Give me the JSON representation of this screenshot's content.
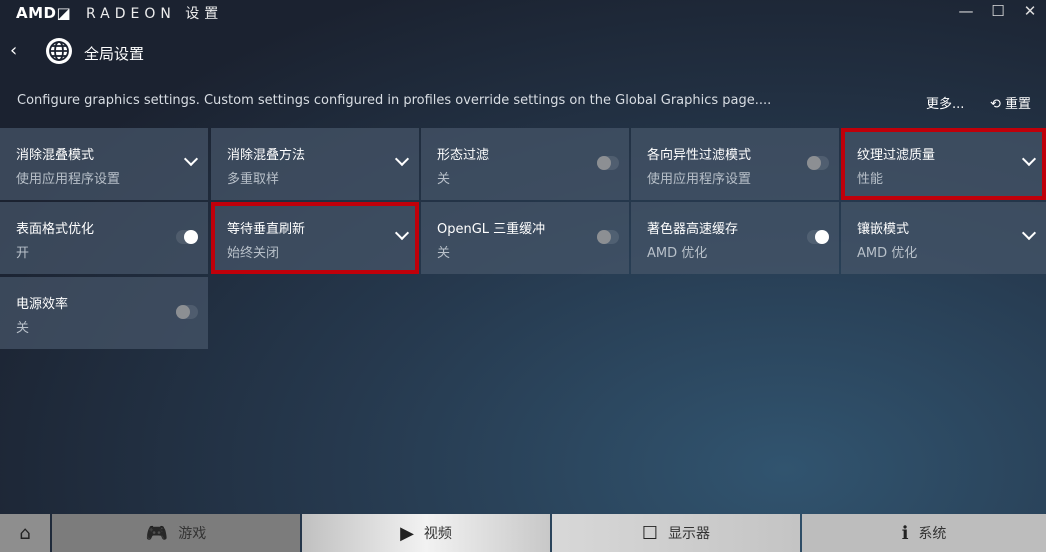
{
  "titlebar": {
    "logo": "AMD◪",
    "title": "RADEON 设置",
    "minimize": "—",
    "maximize": "☐",
    "close": "✕"
  },
  "nav": {
    "back": "‹",
    "title": "全局设置"
  },
  "description": "Configure graphics settings. Custom settings configured in profiles override settings on the Global Graphics page....",
  "actions": {
    "more": "更多...",
    "reset": "重置",
    "reset_icon": "⟲"
  },
  "tiles": [
    {
      "name": "消除混叠模式",
      "value": "使用应用程序设置",
      "control": "dropdown"
    },
    {
      "name": "消除混叠方法",
      "value": "多重取样",
      "control": "dropdown"
    },
    {
      "name": "形态过滤",
      "value": "关",
      "control": "toggle",
      "on": false
    },
    {
      "name": "各向异性过滤模式",
      "value": "使用应用程序设置",
      "control": "toggle",
      "on": false
    },
    {
      "name": "纹理过滤质量",
      "value": "性能",
      "control": "dropdown",
      "highlighted": true
    },
    {
      "name": "表面格式优化",
      "value": "开",
      "control": "toggle",
      "on": true
    },
    {
      "name": "等待垂直刷新",
      "value": "始终关闭",
      "control": "dropdown",
      "highlighted": true
    },
    {
      "name": "OpenGL 三重缓冲",
      "value": "关",
      "control": "toggle",
      "on": false
    },
    {
      "name": "著色器高速缓存",
      "value": "AMD 优化",
      "control": "toggle",
      "on": true
    },
    {
      "name": "镶嵌模式",
      "value": "AMD 优化",
      "control": "dropdown"
    },
    {
      "name": "电源效率",
      "value": "关",
      "control": "toggle",
      "on": false
    }
  ],
  "bottom": {
    "home_icon": "⌂",
    "games": "游戏",
    "games_icon": "🎮",
    "video": "视频",
    "video_icon": "▶",
    "display": "显示器",
    "display_icon": "☐",
    "system": "系统",
    "system_icon": "ℹ"
  },
  "colors": {
    "highlight": "#c0000a"
  }
}
